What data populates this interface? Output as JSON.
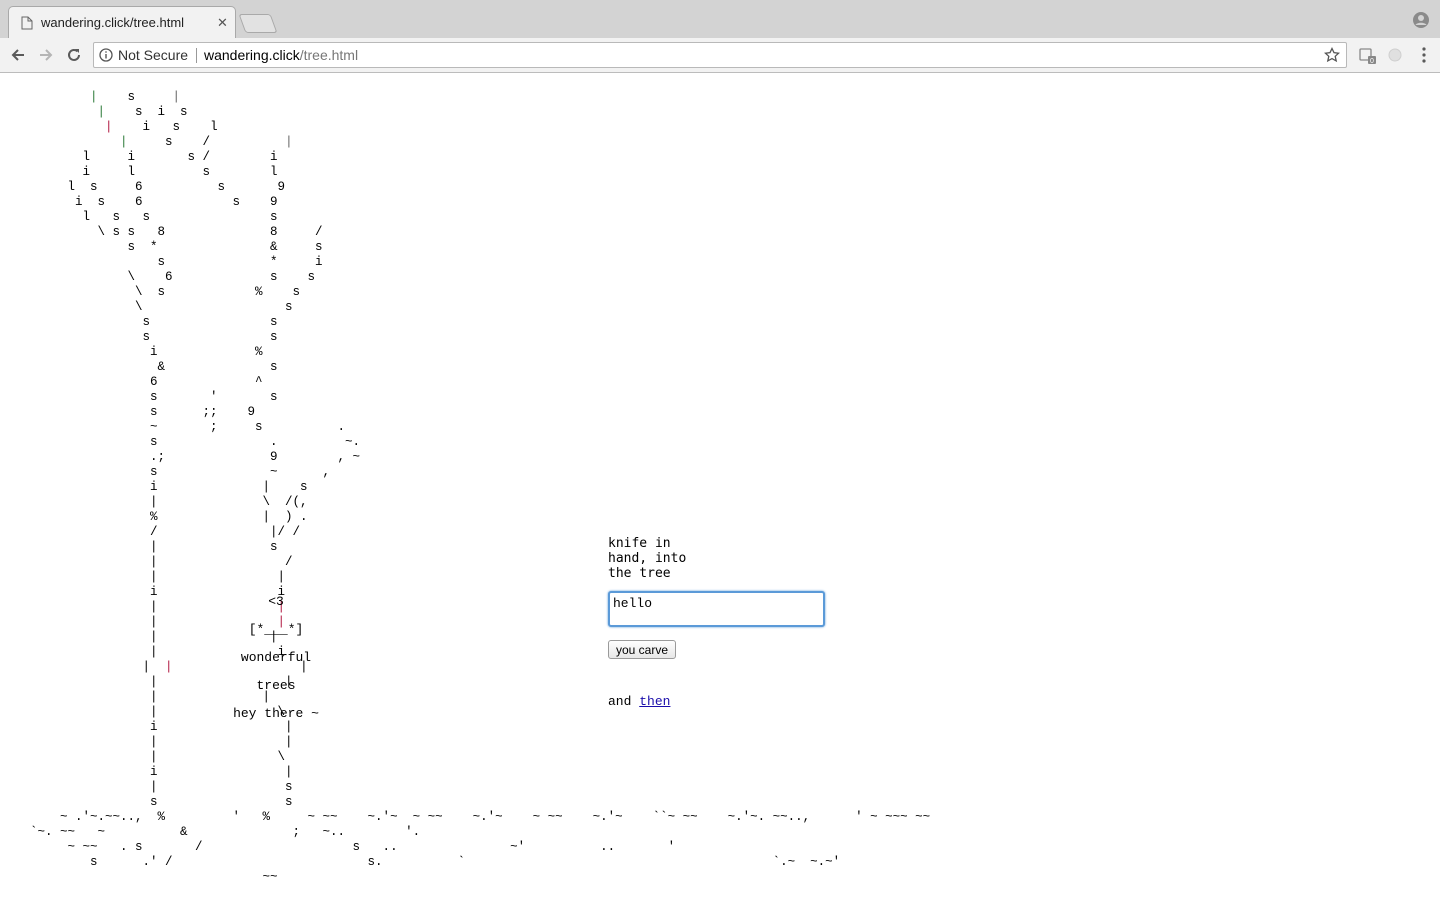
{
  "browser": {
    "tab_title": "wandering.click/tree.html",
    "security_label": "Not Secure",
    "url_domain": "wandering.click",
    "url_path": "/tree.html"
  },
  "icons": {
    "back": "arrow-left-icon",
    "forward": "arrow-right-icon",
    "reload": "reload-icon",
    "info": "info-icon",
    "bookmark": "star-icon",
    "menu": "three-dots-icon",
    "profile": "person-icon",
    "extension": "extension-icon"
  },
  "colors": {
    "link": "#1a0dab",
    "focus_ring": "#5b9ad8",
    "carve_mark": "#b21a42"
  },
  "tree": {
    "carvings": [
      "<3",
      "[*___*]",
      "wonderful",
      "trees",
      "hey there ~"
    ]
  },
  "panel": {
    "prompt": "knife in\nhand, into\nthe tree",
    "input_value": "hello",
    "button_label": "you carve",
    "and_text": "and ",
    "link_text": "then"
  }
}
